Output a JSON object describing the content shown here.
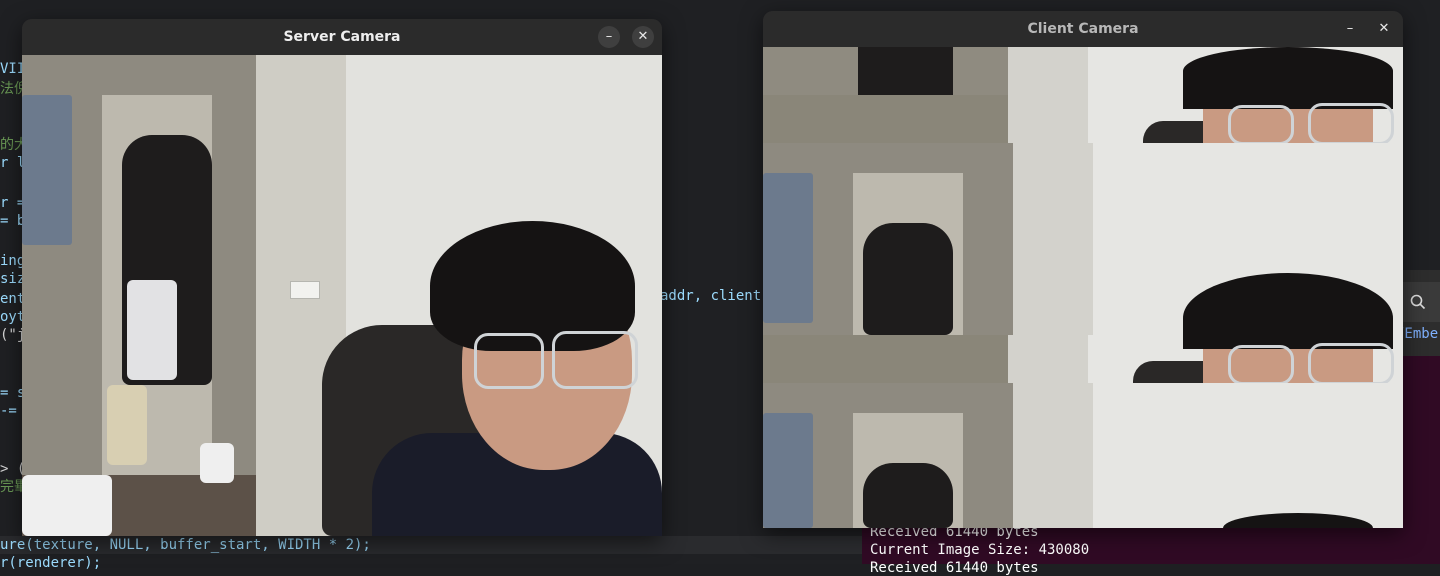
{
  "server_window": {
    "title": "Server Camera",
    "minimize_label": "–",
    "close_label": "✕"
  },
  "client_window": {
    "title": "Client Camera",
    "minimize_label": "–",
    "close_label": "✕"
  },
  "editor": {
    "left_fragments": [
      "VII",
      "法倪",
      "的大",
      "r le",
      "r =",
      "= b",
      "ing",
      "siz",
      "ent_",
      "oyte",
      "(\"j",
      "= s",
      "-=",
      "> (",
      "完畢"
    ],
    "right_fragment": "addr, client",
    "bottom_lines": [
      "ure(texture, NULL, buffer_start, WIDTH * 2);",
      "r(renderer);"
    ]
  },
  "terminal": {
    "tab_fragment": "/Embe",
    "lines": [
      "Received 61440 bytes",
      "Current Image Size: 430080",
      "Received 61440 bytes"
    ]
  },
  "icons": {
    "search": "search-icon",
    "minimize": "minimize-icon",
    "close": "close-icon"
  }
}
